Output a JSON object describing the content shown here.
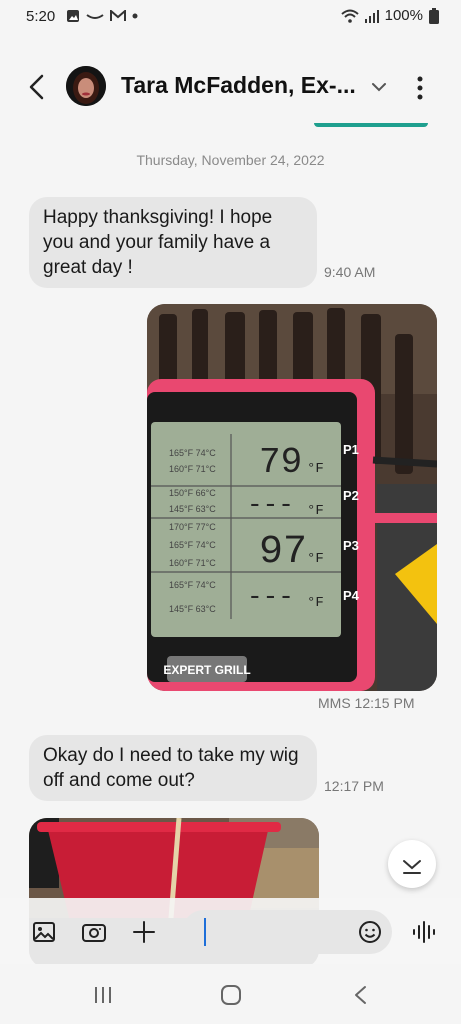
{
  "status_bar": {
    "time": "5:20",
    "battery": "100%"
  },
  "header": {
    "contact_name": "Tara McFadden, Ex-..."
  },
  "conversation": {
    "date_separator": "Thursday, November 24, 2022",
    "messages": [
      {
        "direction": "incoming",
        "type": "text",
        "text": "Happy thanksgiving! I hope you and your family have a great day !",
        "time": "9:40 AM"
      },
      {
        "direction": "outgoing",
        "type": "image",
        "image_label": "Photo of an Expert Grill meat thermometer display",
        "time": "MMS 12:15 PM"
      },
      {
        "direction": "incoming",
        "type": "text",
        "text": "Okay do I need to take my wig off and come out?",
        "time": "12:17 PM"
      },
      {
        "direction": "incoming",
        "type": "image",
        "image_label": "Photo of a red bucket"
      }
    ],
    "thermometer": {
      "probes": [
        "P1",
        "P2",
        "P3",
        "P4"
      ],
      "readings": [
        "79",
        "---",
        "97",
        "---"
      ],
      "unit": "°F",
      "brand": "EXPERT GRILL",
      "table_rows": [
        [
          "165°F 74°C",
          "160°F 71°C",
          "150°F 66°C",
          "145°F 63°C"
        ],
        [
          "170°F 77°C",
          "165°F 74°C",
          "160°F 71°C"
        ],
        [
          "165°F 74°C",
          "145°F 63°C"
        ]
      ]
    }
  },
  "compose": {
    "placeholder": ""
  },
  "colors": {
    "accent": "#1e9f8e",
    "bubble": "#e6e6e6",
    "background": "#f5f5f5",
    "cursor": "#1e6fd9"
  },
  "icons": [
    "image-icon",
    "silence-icon",
    "gmail-icon",
    "wifi-icon",
    "signal-icon",
    "battery-icon",
    "back-icon",
    "chevron-down-icon",
    "more-vert-icon",
    "gallery-icon",
    "camera-icon",
    "plus-icon",
    "emoji-icon",
    "voice-icon",
    "recents-icon",
    "home-icon",
    "nav-back-icon"
  ]
}
